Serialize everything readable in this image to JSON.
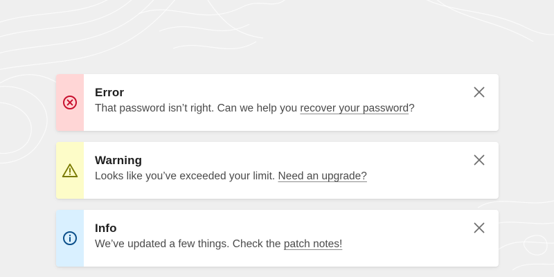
{
  "colors": {
    "background": "#efefef",
    "card": "#ffffff",
    "error_stripe": "#ffd6d6",
    "error_icon": "#c8102e",
    "warning_stripe": "#fdfcc8",
    "warning_icon": "#7a7a00",
    "info_stripe": "#d9f0ff",
    "info_icon": "#0b4f8a",
    "close_icon": "#6f6f6f"
  },
  "alerts": [
    {
      "type": "error",
      "icon": "error-circle-x-icon",
      "title": "Error",
      "message": "That password isn’t right. Can we help you ",
      "link_text": "recover your password",
      "suffix": "?"
    },
    {
      "type": "warning",
      "icon": "warning-triangle-icon",
      "title": "Warning",
      "message": "Looks like you’ve exceeded your limit. ",
      "link_text": "Need an upgrade?",
      "suffix": ""
    },
    {
      "type": "info",
      "icon": "info-circle-icon",
      "title": "Info",
      "message": "We’ve updated a few things. Check the ",
      "link_text": "patch notes!",
      "suffix": ""
    }
  ]
}
